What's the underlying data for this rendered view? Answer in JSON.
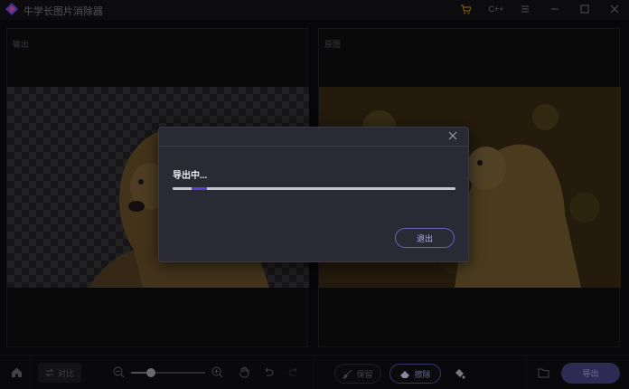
{
  "app": {
    "title": "牛学长图片消除器",
    "colors": {
      "accent": "#5d3fd3",
      "cart": "#a07a10",
      "dialog_bg": "#2a2a34"
    }
  },
  "titlebar": {
    "icons": [
      "cart-icon",
      "crm-icon",
      "menu-icon",
      "minimize-icon",
      "maximize-icon",
      "close-icon"
    ],
    "c_label": "C++"
  },
  "panels": {
    "left_label": "输出",
    "right_label": "原图"
  },
  "toolbar": {
    "compare_label": "对比",
    "zoom_level": 0.27,
    "keep_label": "保留",
    "erase_label": "擦除",
    "export_label": "导出"
  },
  "dialog": {
    "title": "导出中...",
    "progress": 0.12,
    "exit_label": "退出"
  }
}
